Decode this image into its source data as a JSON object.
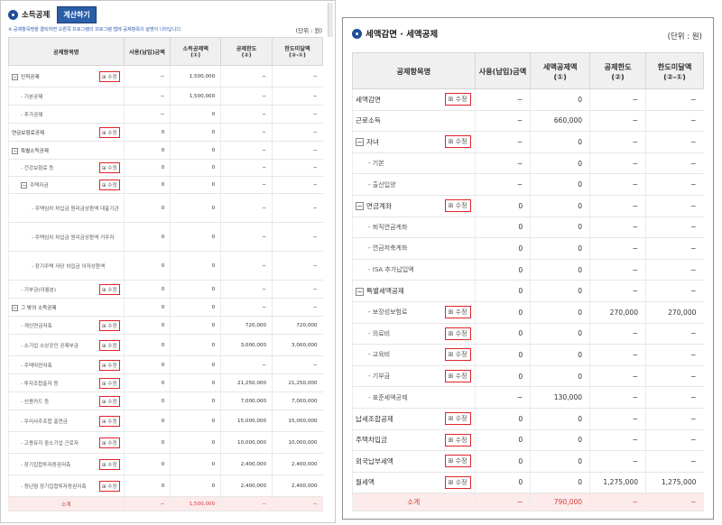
{
  "left": {
    "title": "소득공제",
    "calc_button": "계산하기",
    "note": "※ 공제항목명을 클릭하면 오른쪽 프로그램의 프로그램 탭에 공제항목의 설명이 나타납니다.",
    "unit": "(단위 : 원)",
    "headers": [
      "공제항목명",
      "사용(납입)금액",
      "소득공제액\n(①)",
      "공제한도\n(②)",
      "한도미달액\n(②-①)"
    ],
    "rows": [
      {
        "name": "인적공제",
        "level": 0,
        "expand": "−",
        "edit": true,
        "c1": "−",
        "c2": "1,500,000",
        "c3": "−",
        "c4": "−",
        "h": 24
      },
      {
        "name": "- 기본공제",
        "level": 1,
        "expand": "",
        "edit": false,
        "c1": "−",
        "c2": "1,500,000",
        "c3": "−",
        "c4": "−",
        "h": 20
      },
      {
        "name": "- 추가공제",
        "level": 1,
        "expand": "",
        "edit": false,
        "c1": "−",
        "c2": "0",
        "c3": "−",
        "c4": "−",
        "h": 20
      },
      {
        "name": "연금보험료공제",
        "level": 0,
        "expand": "",
        "edit": true,
        "c1": "0",
        "c2": "0",
        "c3": "−",
        "c4": "−",
        "h": 20
      },
      {
        "name": "특별소득공제",
        "level": 0,
        "expand": "−",
        "edit": false,
        "c1": "0",
        "c2": "0",
        "c3": "−",
        "c4": "−",
        "h": 20
      },
      {
        "name": "- 건강보험료 등",
        "level": 1,
        "expand": "",
        "edit": true,
        "c1": "0",
        "c2": "0",
        "c3": "−",
        "c4": "−",
        "h": 19
      },
      {
        "name": "주택자금",
        "level": 1,
        "expand": "−",
        "edit": true,
        "c1": "0",
        "c2": "0",
        "c3": "−",
        "c4": "−",
        "h": 19
      },
      {
        "name": "- 주택임차 차입금 원리금상환액 대출기관",
        "level": 2,
        "expand": "",
        "edit": false,
        "c1": "0",
        "c2": "0",
        "c3": "−",
        "c4": "−",
        "h": 32
      },
      {
        "name": "- 주택임차 차입금 원리금상환액 거주자",
        "level": 2,
        "expand": "",
        "edit": false,
        "c1": "0",
        "c2": "0",
        "c3": "−",
        "c4": "−",
        "h": 32
      },
      {
        "name": "- 장기주택 저당 차입금 이자상환액",
        "level": 2,
        "expand": "",
        "edit": false,
        "c1": "0",
        "c2": "0",
        "c3": "−",
        "c4": "−",
        "h": 32
      },
      {
        "name": "- 기부금(이월분)",
        "level": 1,
        "expand": "",
        "edit": true,
        "c1": "0",
        "c2": "0",
        "c3": "−",
        "c4": "−",
        "h": 20
      },
      {
        "name": "그 밖의 소득공제",
        "level": 0,
        "expand": "−",
        "edit": false,
        "c1": "0",
        "c2": "0",
        "c3": "−",
        "c4": "−",
        "h": 20
      },
      {
        "name": "- 개인연금저축",
        "level": 1,
        "expand": "",
        "edit": true,
        "c1": "0",
        "c2": "0",
        "c3": "720,000",
        "c4": "720,000",
        "h": 20
      },
      {
        "name": "- 소기업 소상공인 공제부금",
        "level": 1,
        "expand": "",
        "edit": true,
        "c1": "0",
        "c2": "0",
        "c3": "3,000,000",
        "c4": "3,000,000",
        "h": 24
      },
      {
        "name": "- 주택마련저축",
        "level": 1,
        "expand": "",
        "edit": true,
        "c1": "0",
        "c2": "0",
        "c3": "−",
        "c4": "−",
        "h": 20
      },
      {
        "name": "- 투자조합출자 등",
        "level": 1,
        "expand": "",
        "edit": true,
        "c1": "0",
        "c2": "0",
        "c3": "21,250,000",
        "c4": "21,250,000",
        "h": 20
      },
      {
        "name": "- 신용카드 등",
        "level": 1,
        "expand": "",
        "edit": true,
        "c1": "0",
        "c2": "0",
        "c3": "7,000,000",
        "c4": "7,000,000",
        "h": 20
      },
      {
        "name": "- 우리사주조합 출연금",
        "level": 1,
        "expand": "",
        "edit": true,
        "c1": "0",
        "c2": "0",
        "c3": "15,000,000",
        "c4": "15,000,000",
        "h": 24
      },
      {
        "name": "- 고용유지 중소기업 근로자",
        "level": 1,
        "expand": "",
        "edit": true,
        "c1": "0",
        "c2": "0",
        "c3": "10,000,000",
        "c4": "10,000,000",
        "h": 24
      },
      {
        "name": "- 장기집합투자증권저축",
        "level": 1,
        "expand": "",
        "edit": true,
        "c1": "0",
        "c2": "0",
        "c3": "2,400,000",
        "c4": "2,400,000",
        "h": 24
      },
      {
        "name": "- 청년형 장기집합투자증권저축",
        "level": 1,
        "expand": "",
        "edit": true,
        "c1": "0",
        "c2": "0",
        "c3": "2,400,000",
        "c4": "2,400,000",
        "h": 24
      }
    ],
    "total": {
      "name": "소계",
      "c1": "−",
      "c2": "1,500,000",
      "c3": "−",
      "c4": "−"
    },
    "edit_label": "⊞ 수정"
  },
  "right": {
    "title": "세액감면 · 세액공제",
    "unit": "(단위 : 원)",
    "headers": [
      "공제항목명",
      "사용(납입)금액",
      "세액공제액\n(①)",
      "공제한도\n(②)",
      "한도미달액\n(②-①)"
    ],
    "rows": [
      {
        "name": "세액감면",
        "level": 0,
        "expand": "",
        "edit": true,
        "c1": "−",
        "c2": "0",
        "c3": "−",
        "c4": "−"
      },
      {
        "name": "근로소득",
        "level": 0,
        "expand": "",
        "edit": false,
        "c1": "−",
        "c2": "660,000",
        "c3": "−",
        "c4": "−"
      },
      {
        "name": "자녀",
        "level": 0,
        "expand": "−",
        "edit": true,
        "c1": "−",
        "c2": "0",
        "c3": "−",
        "c4": "−"
      },
      {
        "name": "- 기본",
        "level": 1,
        "expand": "",
        "edit": false,
        "c1": "−",
        "c2": "0",
        "c3": "−",
        "c4": "−"
      },
      {
        "name": "- 출산입양",
        "level": 1,
        "expand": "",
        "edit": false,
        "c1": "−",
        "c2": "0",
        "c3": "−",
        "c4": "−"
      },
      {
        "name": "연금계좌",
        "level": 0,
        "expand": "−",
        "edit": true,
        "c1": "0",
        "c2": "0",
        "c3": "−",
        "c4": "−"
      },
      {
        "name": "- 퇴직연금계좌",
        "level": 1,
        "expand": "",
        "edit": false,
        "c1": "0",
        "c2": "0",
        "c3": "−",
        "c4": "−"
      },
      {
        "name": "- 연금저축계좌",
        "level": 1,
        "expand": "",
        "edit": false,
        "c1": "0",
        "c2": "0",
        "c3": "−",
        "c4": "−"
      },
      {
        "name": "- ISA 추가납입액",
        "level": 1,
        "expand": "",
        "edit": false,
        "c1": "0",
        "c2": "0",
        "c3": "−",
        "c4": "−"
      },
      {
        "name": "특별세액공제",
        "level": 0,
        "expand": "−",
        "edit": false,
        "c1": "0",
        "c2": "0",
        "c3": "−",
        "c4": "−"
      },
      {
        "name": "- 보장성보험료",
        "level": 1,
        "expand": "",
        "edit": true,
        "c1": "0",
        "c2": "0",
        "c3": "270,000",
        "c4": "270,000"
      },
      {
        "name": "- 의료비",
        "level": 1,
        "expand": "",
        "edit": true,
        "c1": "0",
        "c2": "0",
        "c3": "−",
        "c4": "−"
      },
      {
        "name": "- 교육비",
        "level": 1,
        "expand": "",
        "edit": true,
        "c1": "0",
        "c2": "0",
        "c3": "−",
        "c4": "−"
      },
      {
        "name": "- 기부금",
        "level": 1,
        "expand": "",
        "edit": true,
        "c1": "0",
        "c2": "0",
        "c3": "−",
        "c4": "−"
      },
      {
        "name": "- 표준세액공제",
        "level": 1,
        "expand": "",
        "edit": false,
        "c1": "−",
        "c2": "130,000",
        "c3": "−",
        "c4": "−"
      },
      {
        "name": "납세조합공제",
        "level": 0,
        "expand": "",
        "edit": true,
        "c1": "0",
        "c2": "0",
        "c3": "−",
        "c4": "−"
      },
      {
        "name": "주택차입금",
        "level": 0,
        "expand": "",
        "edit": true,
        "c1": "0",
        "c2": "0",
        "c3": "−",
        "c4": "−"
      },
      {
        "name": "외국납부세액",
        "level": 0,
        "expand": "",
        "edit": true,
        "c1": "0",
        "c2": "0",
        "c3": "−",
        "c4": "−"
      },
      {
        "name": "월세액",
        "level": 0,
        "expand": "",
        "edit": true,
        "c1": "0",
        "c2": "0",
        "c3": "1,275,000",
        "c4": "1,275,000"
      }
    ],
    "total": {
      "name": "소계",
      "c1": "−",
      "c2": "790,000",
      "c3": "−",
      "c4": "−"
    },
    "edit_label": "⊞ 수정"
  }
}
